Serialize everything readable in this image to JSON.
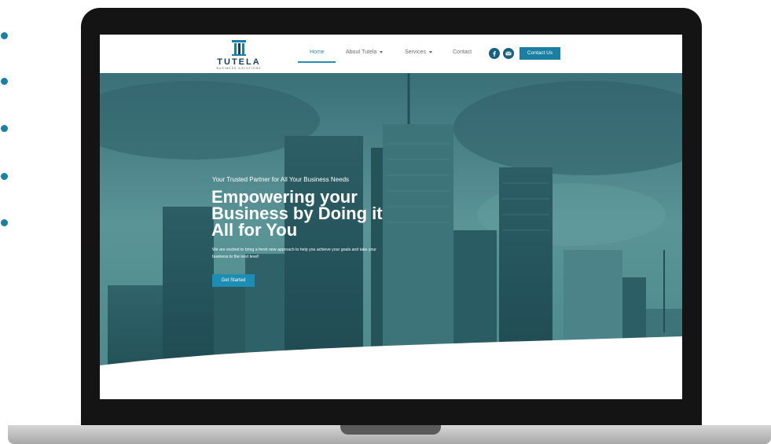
{
  "brand": {
    "name": "TUTELA",
    "subtitle": "BUSINESS SOLUTIONS"
  },
  "nav": {
    "items": [
      {
        "label": "Home",
        "active": true
      },
      {
        "label": "About Tutela",
        "has_dropdown": true
      },
      {
        "label": "Services",
        "has_dropdown": true
      },
      {
        "label": "Contact"
      }
    ],
    "social": [
      "facebook-icon",
      "email-icon"
    ],
    "cta_label": "Contact Us"
  },
  "hero": {
    "tagline": "Your Trusted Partner for All Your Business Needs",
    "headline": "Empowering your Business by Doing it All for You",
    "description": "We are excited to bring a fresh new approach to help you achieve your goals and take your business to the next level!",
    "button_label": "Get Started"
  },
  "colors": {
    "accent": "#1a7fa3",
    "hero_overlay": "#3f7d85",
    "bezel": "#141414"
  }
}
